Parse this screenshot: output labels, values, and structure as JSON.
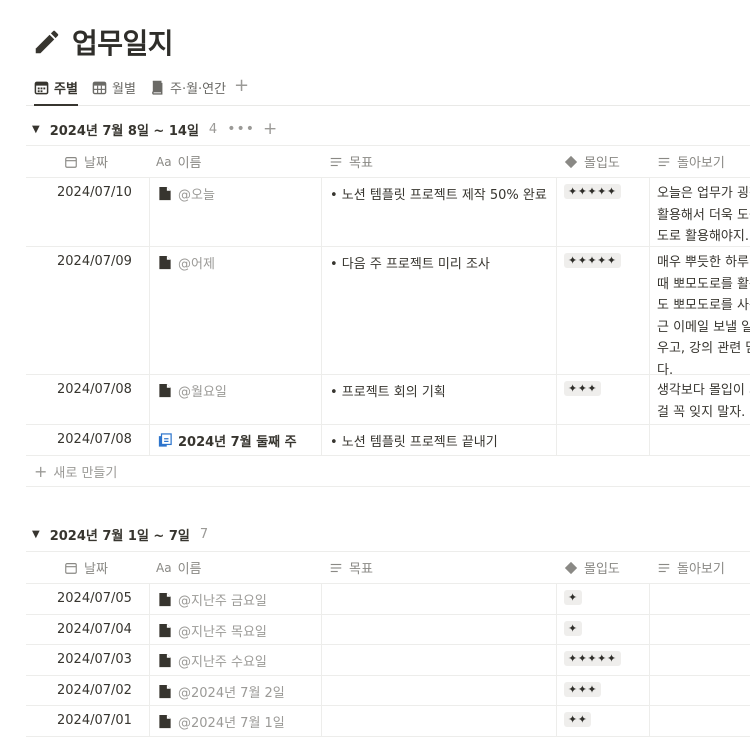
{
  "page": {
    "title": "업무일지",
    "icon": "pencil-icon"
  },
  "tabs": [
    {
      "label": "주별",
      "icon": "calendar-icon",
      "active": true
    },
    {
      "label": "월별",
      "icon": "table-icon",
      "active": false
    },
    {
      "label": "주·월·연간",
      "icon": "book-icon",
      "active": false
    }
  ],
  "columns": {
    "date": "날짜",
    "name_prefix": "Aa",
    "name": "이름",
    "goal": "목표",
    "focus": "몰입도",
    "review": "돌아보기"
  },
  "groups": [
    {
      "label": "2024년 7월 8일 ~ 14일",
      "count": "4",
      "more": "•••",
      "rows": [
        {
          "date": "2024/07/10",
          "name": "@오늘",
          "name_style": "mention",
          "page_icon": "page-icon",
          "goal": "• 노션 템플릿 프로젝트 제작 50% 완료",
          "focus": "✦✦✦✦✦",
          "review": "오늘은 업무가 굉장\n활용해서 더욱 도움\n도로 활용해야지."
        },
        {
          "date": "2024/07/09",
          "name": "@어제",
          "name_style": "mention",
          "page_icon": "page-icon",
          "goal": "• 다음 주 프로젝트 미리 조사",
          "focus": "✦✦✦✦✦",
          "review": "매우 뿌듯한 하루다\n때 뽀모도로를 활용\n도 뽀모도로를 사용\n근 이메일 보낼 일이\n우고, 강의 관련 담\n다."
        },
        {
          "date": "2024/07/08",
          "name": "@월요일",
          "name_style": "mention",
          "page_icon": "page-icon",
          "goal": "• 프로젝트 회의 기획",
          "focus": "✦✦✦",
          "review": "생각보다 몰입이 되\n걸 꼭 잊지 말자."
        },
        {
          "date": "2024/07/08",
          "name": "2024년 7월 둘째 주",
          "name_style": "bold",
          "page_icon": "linked-page-icon",
          "goal": "• 노션 템플릿 프로젝트 끝내기",
          "focus": "",
          "review": ""
        }
      ],
      "new_label": "새로 만들기"
    },
    {
      "label": "2024년 7월 1일 ~ 7일",
      "count": "7",
      "rows": [
        {
          "date": "2024/07/05",
          "name": "@지난주 금요일",
          "name_style": "mention",
          "page_icon": "page-icon",
          "goal": "",
          "focus": "✦",
          "review": ""
        },
        {
          "date": "2024/07/04",
          "name": "@지난주 목요일",
          "name_style": "mention",
          "page_icon": "page-icon",
          "goal": "",
          "focus": "✦",
          "review": ""
        },
        {
          "date": "2024/07/03",
          "name": "@지난주 수요일",
          "name_style": "mention",
          "page_icon": "page-icon",
          "goal": "",
          "focus": "✦✦✦✦✦",
          "review": ""
        },
        {
          "date": "2024/07/02",
          "name": "@2024년 7월 2일",
          "name_style": "mention",
          "page_icon": "page-icon",
          "goal": "",
          "focus": "✦✦✦",
          "review": ""
        },
        {
          "date": "2024/07/01",
          "name": "@2024년 7월 1일",
          "name_style": "mention",
          "page_icon": "page-icon",
          "goal": "",
          "focus": "✦✦",
          "review": ""
        }
      ]
    }
  ],
  "colors": {
    "text": "#37352f",
    "muted": "#9b9a97",
    "border": "#ededeb",
    "tag_bg": "#efeeec",
    "link_icon": "#2e75cc"
  }
}
